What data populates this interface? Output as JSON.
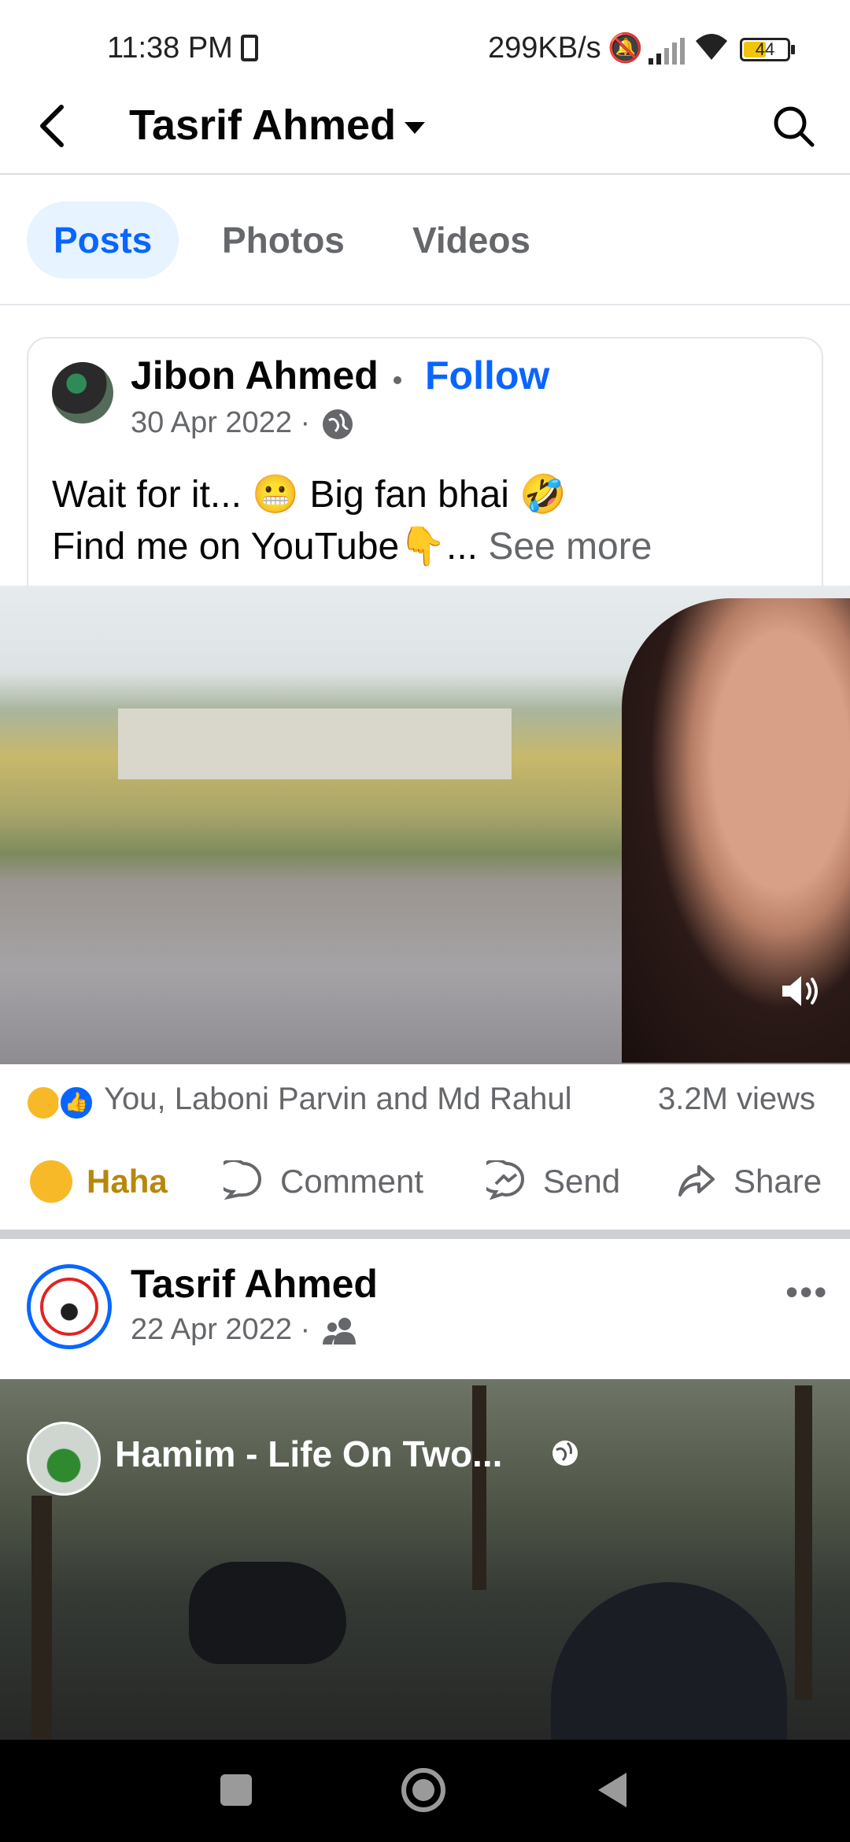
{
  "status_bar": {
    "time": "11:38 PM",
    "network_speed": "299KB/s",
    "battery": "44"
  },
  "header": {
    "title": "Tasrif Ahmed",
    "icons": [
      "back-arrow-icon",
      "dropdown-caret-icon",
      "search-icon"
    ]
  },
  "tabs": [
    {
      "label": "Posts",
      "active": true
    },
    {
      "label": "Photos",
      "active": false
    },
    {
      "label": "Videos",
      "active": false
    }
  ],
  "post1": {
    "author": "Jibon Ahmed",
    "separator": "•",
    "follow_label": "Follow",
    "date": "30 Apr 2022 ·",
    "line1": "Wait for it... 😬 Big fan bhai 🤣",
    "line2": "Find me on YouTube👇...",
    "see_more": "See more",
    "reactions_text": "You, Laboni Parvin and Md Rahul",
    "views": "3.2M views",
    "actions": {
      "haha": "Haha",
      "comment": "Comment",
      "send": "Send",
      "share": "Share"
    }
  },
  "post2": {
    "author": "Tasrif Ahmed",
    "date": "22 Apr 2022 ·",
    "more": "•••",
    "shared_from": "Hamim - Life On Two..."
  },
  "colors": {
    "accent": "#0866ff",
    "haha": "#b8870b",
    "secondary_text": "#65676b"
  }
}
